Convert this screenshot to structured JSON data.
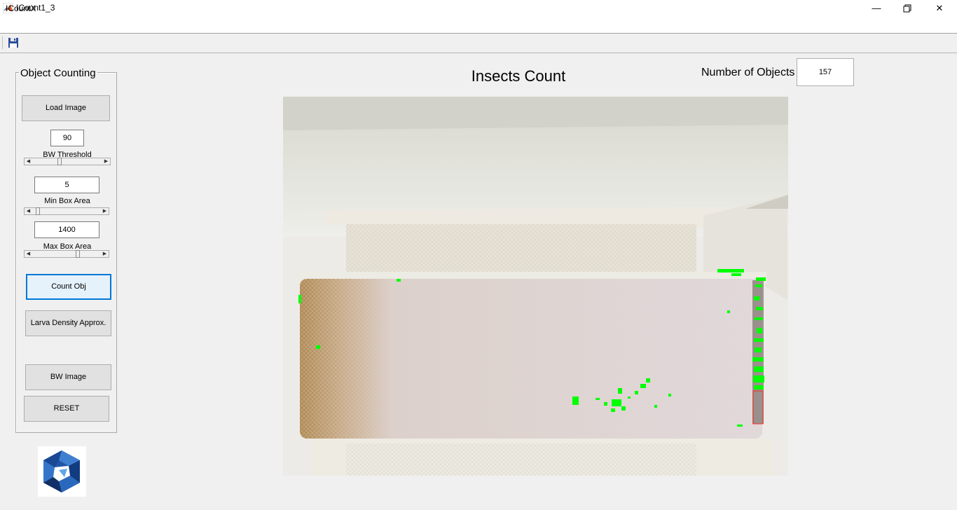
{
  "window": {
    "title": "ICount1_3"
  },
  "menu": {
    "items": [
      "ICountX"
    ]
  },
  "panel": {
    "title": "Object Counting",
    "load_image_label": "Load Image",
    "bw_threshold": {
      "value": "90",
      "label": "BW Threshold",
      "level": 0.45
    },
    "min_box_area": {
      "value": "5",
      "label": "Min Box Area",
      "level": 0.05
    },
    "max_box_area": {
      "value": "1400",
      "label": "Max Box Area",
      "level": 0.7
    },
    "count_obj_label": "Count Obj",
    "larva_density_label": "Larva Density Approx.",
    "bw_image_label": "BW Image",
    "reset_label": "RESET"
  },
  "main": {
    "title": "Insects Count",
    "num_objects_label": "Number of Objects",
    "num_objects_value": "157"
  },
  "colors": {
    "accent": "#0078d7",
    "detection": "#00ff00"
  }
}
